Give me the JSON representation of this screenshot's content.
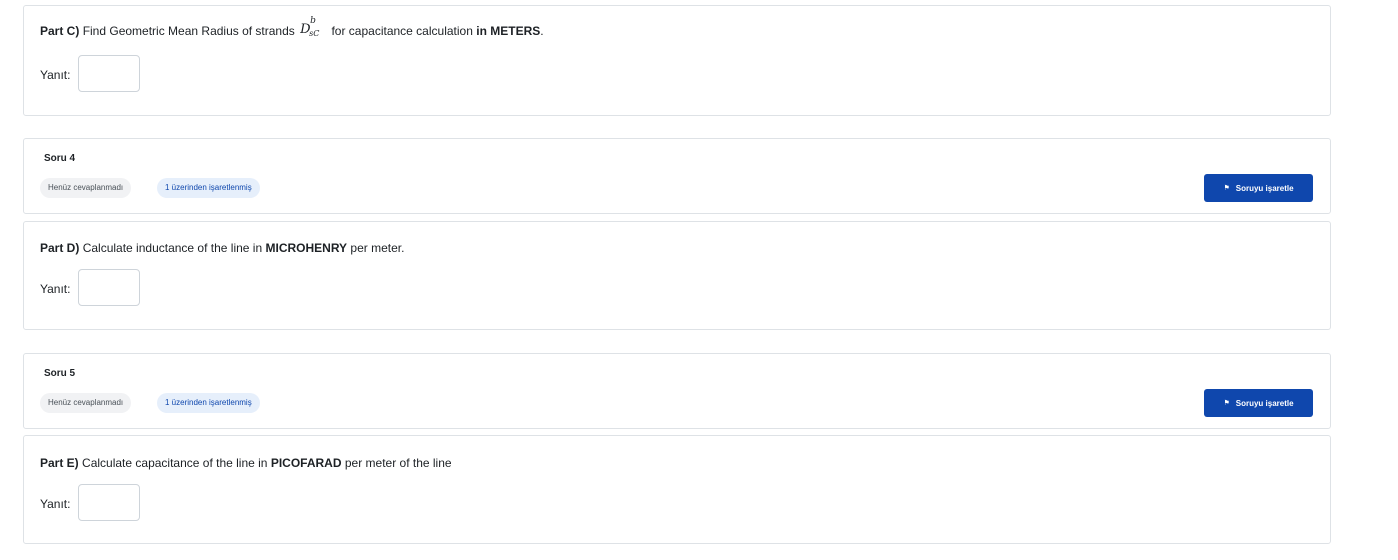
{
  "part_c": {
    "label": "Part C)",
    "text_before": "Find Geometric Mean Radius of strands",
    "math_main": "D",
    "math_sup": "b",
    "math_sub": "sC",
    "text_after": "for capacitance calculation",
    "emphasis": "in METERS",
    "end": ".",
    "answer_label": "Yanıt:"
  },
  "q4": {
    "title": "Soru 4",
    "status": "Henüz cevaplanmadı",
    "marks": "1 üzerinden işaretlenmiş",
    "flag_label": "Soruyu işaretle"
  },
  "part_d": {
    "label": "Part D)",
    "text_before": "Calculate inductance of the line in",
    "emphasis": "MICROHENRY",
    "text_after": "per meter.",
    "answer_label": "Yanıt:"
  },
  "q5": {
    "title": "Soru 5",
    "status": "Henüz cevaplanmadı",
    "marks": "1 üzerinden işaretlenmiş",
    "flag_label": "Soruyu işaretle"
  },
  "part_e": {
    "label": "Part E)",
    "text_before": "Calculate capacitance of the line in",
    "emphasis": "PICOFARAD",
    "text_after": "per meter of the line",
    "answer_label": "Yanıt:"
  },
  "colors": {
    "accent": "#0f47ad",
    "badge_blue_bg": "#e6effb",
    "badge_gray_bg": "#f1f2f4",
    "border": "#dee2e6"
  },
  "icons": {
    "flag": "flag-icon"
  }
}
